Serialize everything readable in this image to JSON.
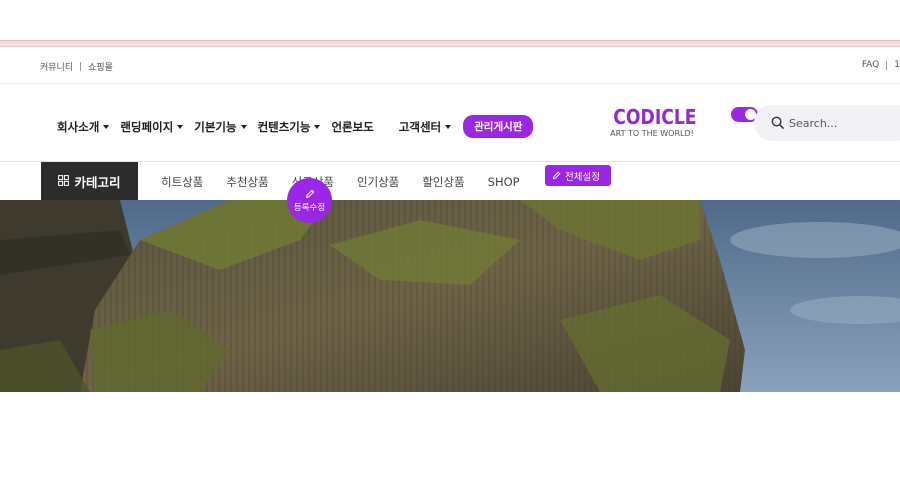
{
  "topbar": {
    "community": "커뮤니티",
    "shop": "쇼핑몰",
    "faq": "FAQ",
    "cut_text": "1"
  },
  "nav": {
    "items": [
      {
        "label": "회사소개",
        "dropdown": true
      },
      {
        "label": "랜딩페이지",
        "dropdown": true
      },
      {
        "label": "기본기능",
        "dropdown": true
      },
      {
        "label": "컨텐츠기능",
        "dropdown": true
      },
      {
        "label": "언론보도",
        "dropdown": false
      },
      {
        "label": "고객센터",
        "dropdown": true
      }
    ],
    "admin_button": "관리게시판"
  },
  "logo": {
    "name": "CODICLE",
    "tagline": "ART TO THE WORLD!"
  },
  "toggle": {
    "state": "on"
  },
  "search": {
    "placeholder": "Search...",
    "value": ""
  },
  "category_bar": {
    "category_button": "카테고리",
    "links": [
      "히트상품",
      "추천상품",
      "신규상품",
      "인기상품",
      "할인상품",
      "SHOP"
    ],
    "settings_button": "전체설정"
  },
  "edit_button": {
    "label": "등록수정"
  },
  "colors": {
    "accent": "#9b27e6",
    "dark": "#2c2c2c",
    "pink_strip": "#f6dcdc"
  },
  "icons": {
    "grid": "grid-icon",
    "search": "search-icon",
    "pencil": "pencil-icon",
    "caret": "caret-down-icon"
  },
  "hero": {
    "image": "rocky-sea-cliff-photo"
  }
}
